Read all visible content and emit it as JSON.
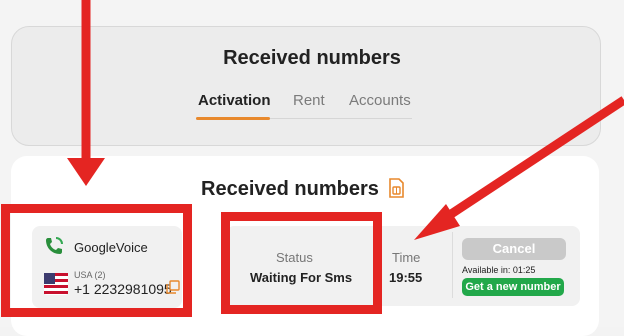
{
  "top": {
    "title": "Received numbers",
    "tabs": [
      {
        "label": "Activation",
        "active": true
      },
      {
        "label": "Rent",
        "active": false
      },
      {
        "label": "Accounts",
        "active": false
      }
    ]
  },
  "section": {
    "title": "Received numbers",
    "icon": "sim-card-icon"
  },
  "number": {
    "service": "GoogleVoice",
    "service_icon": "phone-icon",
    "country": "USA (2)",
    "flag_icon": "usa-flag-icon",
    "phone": "+1 2232981095",
    "copy_icon": "copy-icon"
  },
  "status": {
    "label": "Status",
    "value": "Waiting For Sms"
  },
  "time": {
    "label": "Time",
    "value": "19:55"
  },
  "actions": {
    "cancel_label": "Cancel",
    "available_text": "Available in:  01:25",
    "get_new_label": "Get a new number"
  },
  "colors": {
    "accent": "#e8892d",
    "annotation": "#e42522",
    "success": "#22a84a",
    "disabled": "#c9c9c9"
  }
}
